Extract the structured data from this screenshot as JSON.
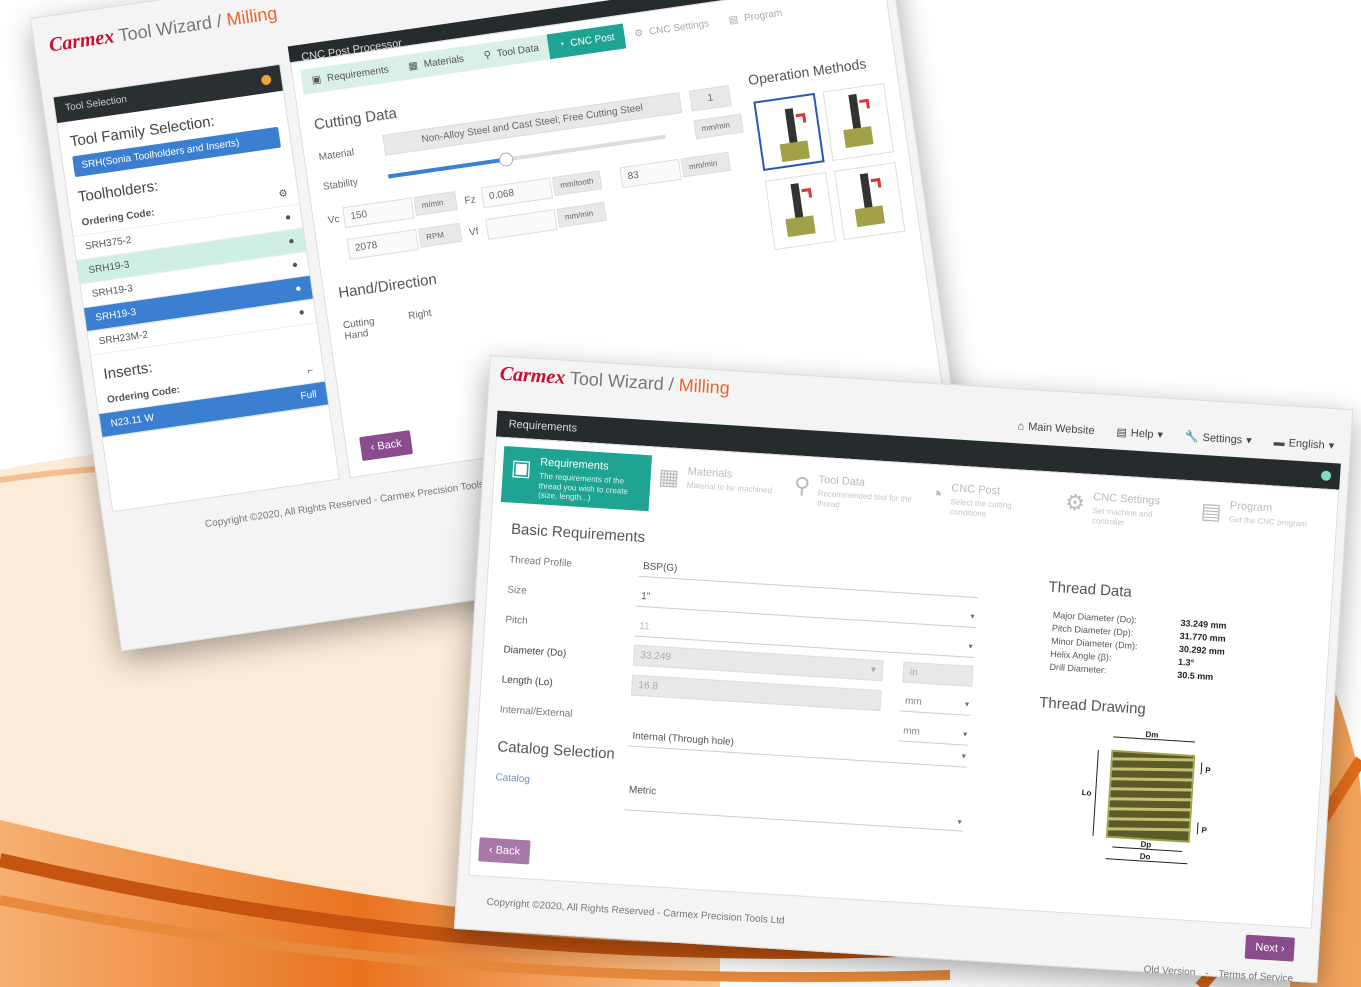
{
  "background_colors": {
    "orange": "#e8731f",
    "light_orange": "#f6b071"
  },
  "nav": {
    "main_website": "Main Website",
    "help": "Help",
    "settings": "Settings",
    "language": "English"
  },
  "logo": {
    "brand": "Carmex",
    "tool_wizard": "Tool Wizard /",
    "module": "Milling"
  },
  "back_window": {
    "sidebar": {
      "header": "Tool Selection",
      "family_title": "Tool Family Selection:",
      "family_value": "SRH(Sonia Toolholders and Inserts)",
      "toolholders_title": "Toolholders:",
      "ordering_code_label": "Ordering Code:",
      "toolholders": [
        "SRH375-2",
        "SRH19-3",
        "SRH19-3",
        "SRH19-3",
        "SRH23M-2"
      ],
      "inserts_title": "Inserts:",
      "insert_ordering_label": "Ordering Code:",
      "insert_value": "N23.11 W",
      "insert_badge": "Full"
    },
    "main": {
      "header": "CNC Post Processor",
      "tabs": [
        "Requirements",
        "Materials",
        "Tool Data",
        "CNC Post",
        "CNC Settings",
        "Program"
      ],
      "cutting_data_title": "Cutting Data",
      "material_label": "Material",
      "material_value": "Non-Alloy Steel and Cast Steel; Free Cutting Steel",
      "material_num": "1",
      "stability_label": "Stability",
      "stability_unit": "mm/min",
      "vc_label": "Vc",
      "vc_value": "150",
      "vc_unit": "m/min",
      "fz_label": "Fz",
      "fz_value": "0.068",
      "fz_unit": "mm/tooth",
      "ap_value": "83",
      "ap_unit": "mm/min",
      "n_value": "2078",
      "n_unit": "RPM",
      "vf_label": "Vf",
      "vf_unit": "mm/min",
      "hand_title": "Hand/Direction",
      "cutting_hand_label": "Cutting Hand",
      "cutting_hand_value": "Right",
      "op_methods_title": "Operation Methods",
      "back_button": "‹ Back"
    },
    "copyright": "Copyright ©2020, All Rights Reserved - Carmex Precision Tools Ltd"
  },
  "front_window": {
    "header": "Requirements",
    "steps": [
      {
        "title": "Requirements",
        "sub": "The requirements of the thread you wish to create (size, length...)"
      },
      {
        "title": "Materials",
        "sub": "Material to be machined"
      },
      {
        "title": "Tool Data",
        "sub": "Recommended tool for the thread"
      },
      {
        "title": "CNC Post",
        "sub": "Select the cutting conditions"
      },
      {
        "title": "CNC Settings",
        "sub": "Set machine and controller"
      },
      {
        "title": "Program",
        "sub": "Get the CNC program"
      }
    ],
    "basic_title": "Basic Requirements",
    "fields": {
      "thread_profile_label": "Thread Profile",
      "thread_profile_value": "BSP(G)",
      "size_label": "Size",
      "size_value": "1\"",
      "pitch_label": "Pitch",
      "pitch_value": "11",
      "diameter_label": "Diameter (Do)",
      "diameter_value": "33.249",
      "diameter_unit": "in",
      "length_label": "Length (Lo)",
      "length_value": "16.8",
      "length_unit": "mm",
      "internal_label": "Internal/External",
      "internal_unit": "mm",
      "internal_value": "Internal (Through hole)"
    },
    "catalog_title": "Catalog Selection",
    "catalog_label": "Catalog",
    "catalog_value": "Metric",
    "back_button": "‹ Back",
    "next_button": "Next ›",
    "thread_data": {
      "title": "Thread Data",
      "rows": [
        {
          "label": "Major Diameter (Do):",
          "value": "33.249 mm"
        },
        {
          "label": "Pitch Diameter (Dp):",
          "value": "31.770 mm"
        },
        {
          "label": "Minor Diameter (Dm):",
          "value": "30.292 mm"
        },
        {
          "label": "Helix Angle (β):",
          "value": "1.3°"
        },
        {
          "label": "Drill Diameter:",
          "value": "30.5 mm"
        }
      ]
    },
    "drawing_title": "Thread Drawing",
    "drawing_labels": {
      "dm": "Dm",
      "dp": "Dp",
      "do": "Do",
      "lo": "Lo",
      "p": "P"
    },
    "copyright": "Copyright ©2020, All Rights Reserved - Carmex Precision Tools Ltd",
    "footer_links": [
      "Old Version",
      "Terms of Service"
    ]
  }
}
